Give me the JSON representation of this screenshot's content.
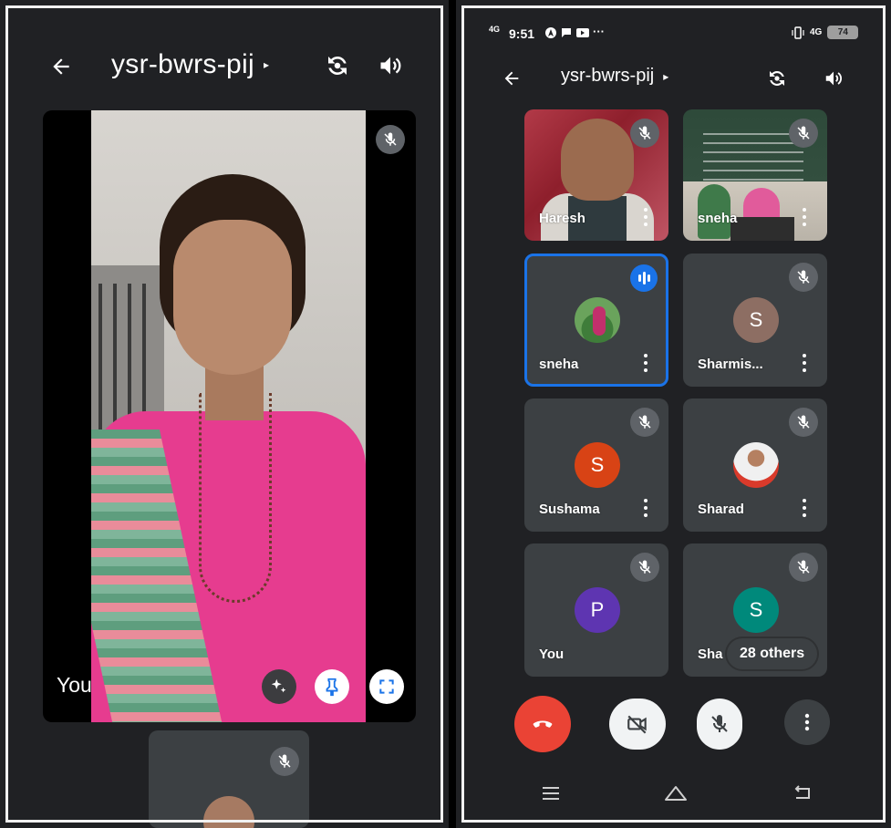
{
  "left_panel": {
    "title": "ysr-bwrs-pij",
    "title_caret": "▸",
    "self_label": "You"
  },
  "right_panel": {
    "status": {
      "signal": "4G",
      "time": "9:51",
      "more": "···",
      "network": "4G",
      "battery": "74"
    },
    "title": "ysr-bwrs-pij",
    "title_caret": "▸",
    "participants": [
      {
        "name": "Haresh",
        "kind": "video",
        "muted": true
      },
      {
        "name": "sneha",
        "kind": "video",
        "muted": true
      },
      {
        "name": "sneha",
        "kind": "photo",
        "speaking": true
      },
      {
        "name": "Sharmis...",
        "kind": "letter",
        "initial": "S",
        "color": "#8d6e63",
        "muted": true
      },
      {
        "name": "Sushama",
        "kind": "letter",
        "initial": "S",
        "color": "#d84315",
        "muted": true
      },
      {
        "name": "Sharad",
        "kind": "photo",
        "muted": true
      },
      {
        "name": "You",
        "kind": "letter",
        "initial": "P",
        "color": "#5e35b1",
        "muted": true
      },
      {
        "name": "Sha",
        "kind": "letter",
        "initial": "S",
        "color": "#00897b",
        "muted": true
      }
    ],
    "others_chip": "28 others"
  },
  "colors": {
    "background": "#202124",
    "tile": "#3c4043",
    "end_call": "#ea4335",
    "active_speaker": "#1a73e8"
  }
}
